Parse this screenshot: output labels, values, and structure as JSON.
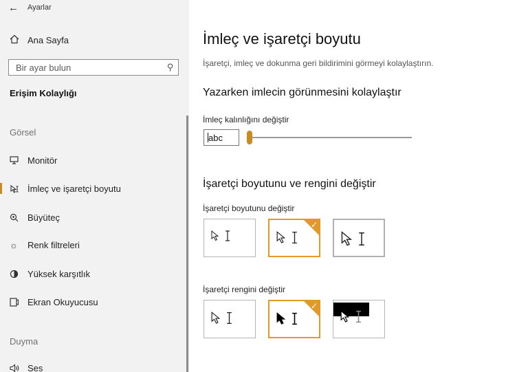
{
  "app": {
    "title": "Ayarlar",
    "back_icon": "back-arrow-icon"
  },
  "sidebar": {
    "home": {
      "label": "Ana Sayfa",
      "icon": "home-icon"
    },
    "search": {
      "placeholder": "Bir ayar bulun",
      "icon": "search-icon"
    },
    "category": "Erişim Kolaylığı",
    "sections": [
      {
        "label": "Görsel",
        "items": [
          {
            "label": "Monitör",
            "icon": "monitor-icon"
          },
          {
            "label": "İmleç ve işaretçi boyutu",
            "icon": "pointer-icon",
            "selected": true
          },
          {
            "label": "Büyüteç",
            "icon": "magnifier-icon"
          },
          {
            "label": "Renk filtreleri",
            "icon": "brightness-icon"
          },
          {
            "label": "Yüksek karşıtlık",
            "icon": "contrast-icon"
          },
          {
            "label": "Ekran Okuyucusu",
            "icon": "narrator-icon"
          }
        ]
      },
      {
        "label": "Duyma",
        "items": [
          {
            "label": "Ses",
            "icon": "speaker-icon"
          }
        ]
      }
    ]
  },
  "main": {
    "title": "İmleç ve işaretçi boyutu",
    "description": "İşaretçi, imleç ve dokunma geri bildirimini görmeyi kolaylaştırın.",
    "cursor_section": {
      "heading": "Yazarken imlecin görünmesini kolaylaştır",
      "thickness_label": "İmleç kalınlığını değiştir",
      "preview_text": "abc",
      "thickness_level": 0.0
    },
    "pointer_section": {
      "heading": "İşaretçi boyutunu ve rengini değiştir",
      "size_label": "İşaretçi boyutunu değiştir",
      "size_options": [
        {
          "name": "small",
          "selected": false
        },
        {
          "name": "medium",
          "selected": true
        },
        {
          "name": "large",
          "selected": false
        }
      ],
      "color_label": "İşaretçi rengini değiştir",
      "color_options": [
        {
          "name": "white",
          "selected": false
        },
        {
          "name": "black",
          "selected": true
        },
        {
          "name": "inverted",
          "selected": false
        }
      ]
    }
  },
  "colors": {
    "accent": "#c98a1e",
    "selection_border": "#e19a2a",
    "sidebar_bg": "#f2f2f2"
  }
}
